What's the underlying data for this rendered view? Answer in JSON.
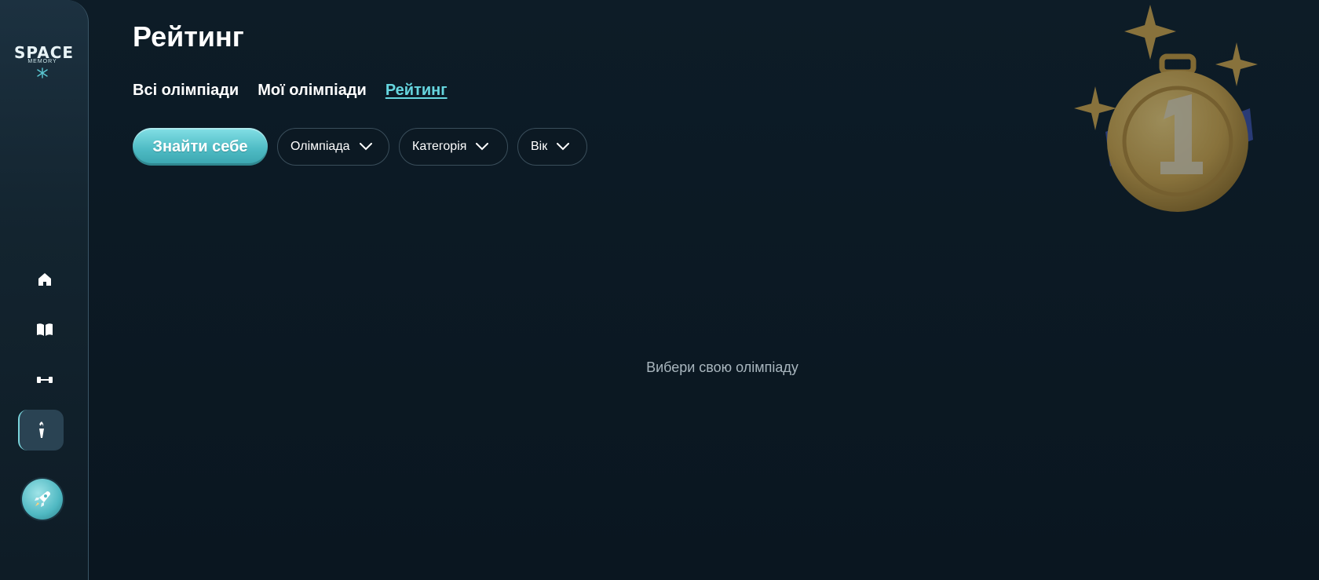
{
  "app": {
    "logo_word": "SPACE",
    "logo_sub": "MEMORY"
  },
  "sidebar": {
    "items": [
      {
        "name": "home",
        "icon": "home-icon"
      },
      {
        "name": "book",
        "icon": "book-icon"
      },
      {
        "name": "dumbbell",
        "icon": "dumbbell-icon"
      },
      {
        "name": "olympiad",
        "icon": "torch-icon",
        "active": true
      }
    ],
    "avatar_icon": "rocket-icon"
  },
  "header": {
    "title": "Рейтинг"
  },
  "tabs": [
    {
      "label": "Всі олімпіади",
      "active": false
    },
    {
      "label": "Мої олімпіади",
      "active": false
    },
    {
      "label": "Рейтинг",
      "active": true
    }
  ],
  "filters": {
    "find_label": "Знайти себе",
    "olympiad_label": "Олімпіада",
    "category_label": "Категорія",
    "age_label": "Вік"
  },
  "main": {
    "empty_message": "Вибери свою олімпіаду"
  },
  "colors": {
    "accent": "#66d6df",
    "background": "#0b1822",
    "medal_gold": "#d4a84a",
    "ribbon_blue": "#3b4fa8"
  }
}
